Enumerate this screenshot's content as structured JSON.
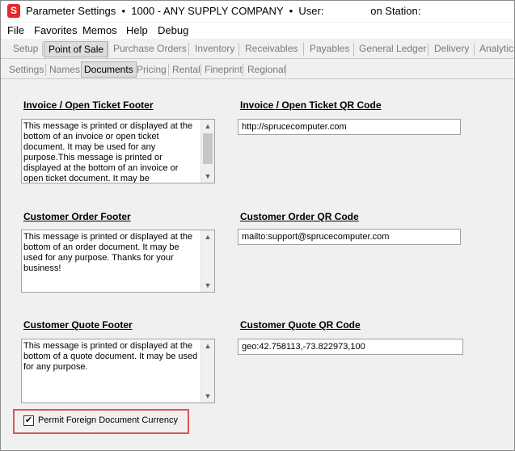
{
  "window": {
    "app_icon_letter": "S",
    "title": "Parameter Settings  •  1000 - ANY SUPPLY COMPANY  •  User:                on Station:"
  },
  "menu": [
    "File",
    "Favorites",
    "Memos",
    "Help",
    "Debug"
  ],
  "main_tabs": [
    "Setup",
    "Point of Sale",
    "Purchase Orders",
    "Inventory",
    "Receivables",
    "Payables",
    "General Ledger",
    "Delivery",
    "Analytics"
  ],
  "main_tabs_active": "Point of Sale",
  "sub_tabs": [
    "Settings",
    "Names",
    "Documents",
    "Pricing",
    "Rental",
    "Fineprint",
    "Regional"
  ],
  "sub_tabs_active": "Documents",
  "invoice": {
    "footer_label": "Invoice / Open Ticket Footer",
    "footer_text": "This message is printed or displayed at the bottom of an invoice or open ticket document.  It may be used for any purpose.This message is printed or displayed at the bottom of an invoice or open ticket document.  It may be",
    "qr_label": "Invoice / Open Ticket QR Code",
    "qr_value": "http://sprucecomputer.com"
  },
  "order": {
    "footer_label": "Customer Order Footer",
    "footer_text": "This message is printed or displayed at the bottom of an order document.  It may be used for any purpose.    Thanks for your business!",
    "qr_label": "Customer Order QR Code",
    "qr_value": "mailto:support@sprucecomputer.com"
  },
  "quote": {
    "footer_label": "Customer Quote Footer",
    "footer_text": "This message is printed or displayed at the bottom of a quote document.  It may be used for any purpose.",
    "qr_label": "Customer Quote QR Code",
    "qr_value": "geo:42.758113,-73.822973,100"
  },
  "permit_currency": {
    "label": "Permit Foreign Document Currency",
    "checked": true,
    "check_glyph": "✔"
  },
  "colors": {
    "highlight": "#e0534d",
    "app_icon": "#e8262b"
  }
}
